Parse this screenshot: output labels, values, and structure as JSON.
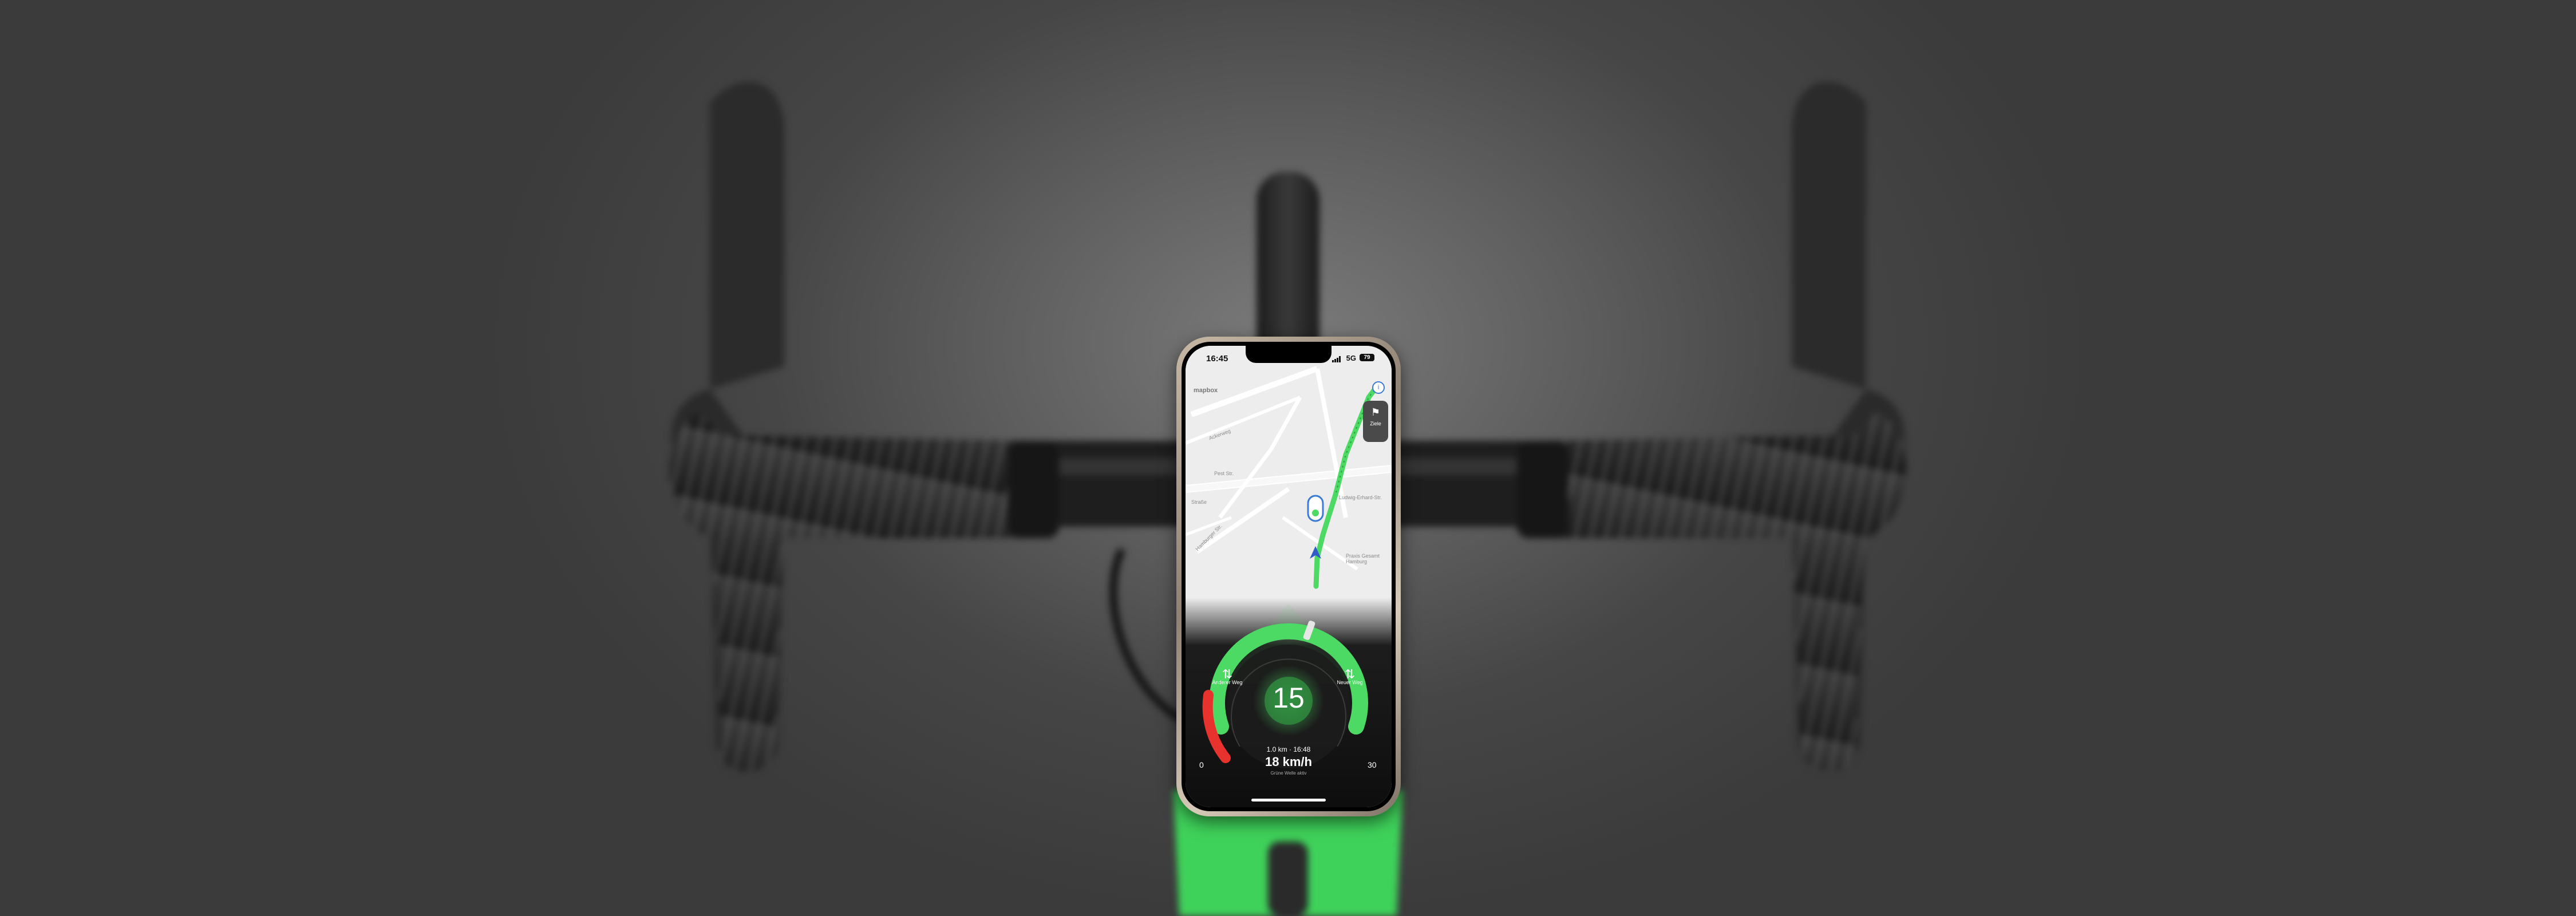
{
  "status_bar": {
    "time": "16:45",
    "network": "5G",
    "battery": "79"
  },
  "map": {
    "logo": "mapbox",
    "street_labels": [
      "Straße",
      "Ludwig-Erhard-Str.",
      "Ackerweg",
      "Hamburger Str.",
      "Pest Str."
    ],
    "poi_label": "Praxis Gesamt Hamburg",
    "flag_button_label": "Ziele",
    "route_color": "#4cd964"
  },
  "gauge": {
    "speed_recommendation": "15",
    "min_label": "0",
    "max_label": "30",
    "left_button_label": "Anderer Weg",
    "right_button_label": "Neuer Weg",
    "distance_eta": "1.0 km · 16:48",
    "current_speed": "18 km/h",
    "footnote": "Grüne Welle aktiv",
    "colors": {
      "green": "#4cd964",
      "red": "#e8322d"
    }
  }
}
